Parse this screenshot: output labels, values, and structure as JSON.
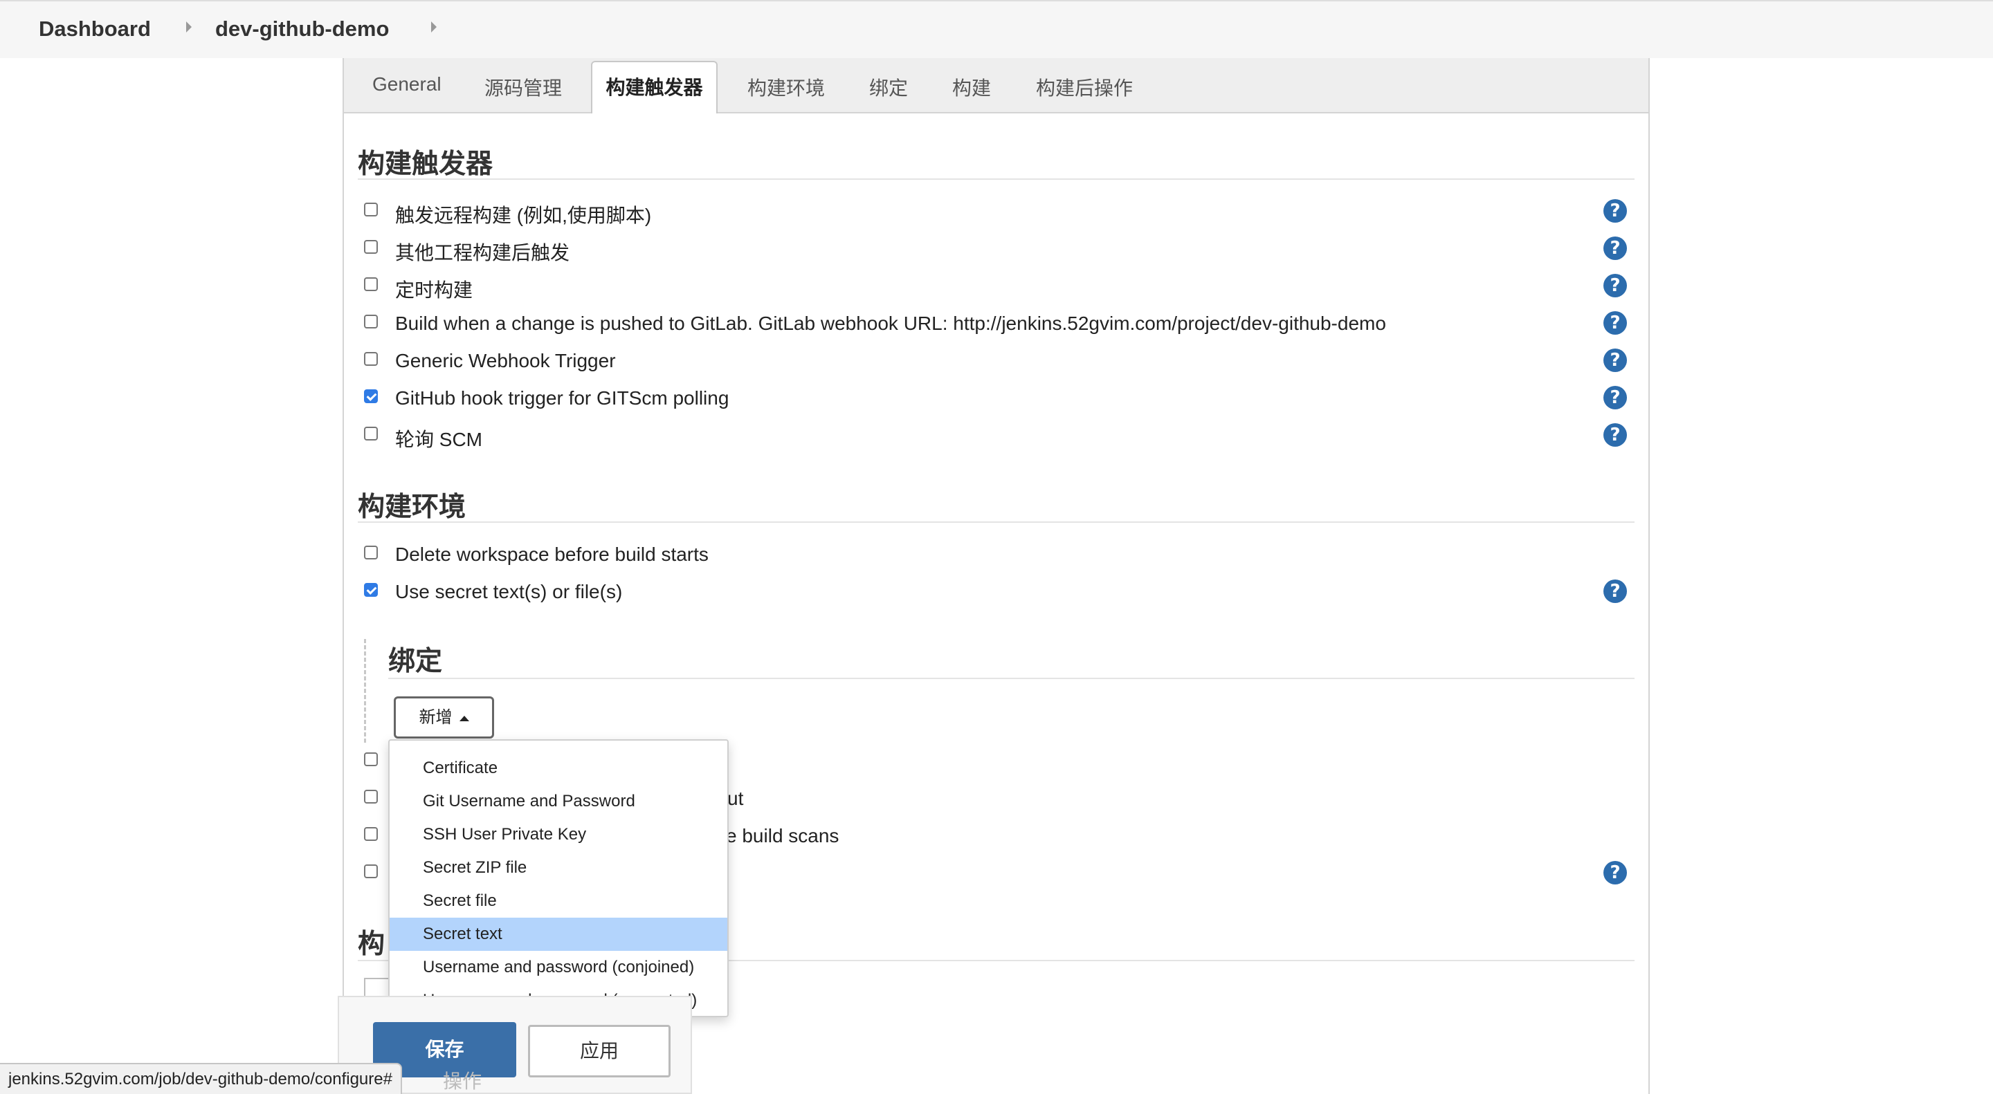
{
  "breadcrumb": {
    "items": [
      "Dashboard",
      "dev-github-demo"
    ]
  },
  "tabs": [
    "General",
    "源码管理",
    "构建触发器",
    "构建环境",
    "绑定",
    "构建",
    "构建后操作"
  ],
  "active_tab": "构建触发器",
  "sections": {
    "triggers": {
      "title": "构建触发器",
      "items": [
        {
          "label": "触发远程构建 (例如,使用脚本)",
          "checked": false
        },
        {
          "label": "其他工程构建后触发",
          "checked": false
        },
        {
          "label": "定时构建",
          "checked": false
        },
        {
          "label": "Build when a change is pushed to GitLab. GitLab webhook URL: http://jenkins.52gvim.com/project/dev-github-demo",
          "checked": false
        },
        {
          "label": "Generic Webhook Trigger",
          "checked": false
        },
        {
          "label": "GitHub hook trigger for GITScm polling",
          "checked": true
        },
        {
          "label": "轮询 SCM",
          "checked": false
        }
      ]
    },
    "env": {
      "title": "构建环境",
      "items": [
        {
          "label": "Delete workspace before build starts",
          "checked": false
        },
        {
          "label": "Use secret text(s) or file(s)",
          "checked": true
        }
      ],
      "partial_labels": [
        "ut",
        "e build scans"
      ]
    },
    "bindings": {
      "title": "绑定",
      "add_button": "新增",
      "dropdown": [
        "Certificate",
        "Git Username and Password",
        "SSH User Private Key",
        "Secret ZIP file",
        "Secret file",
        "Secret text",
        "Username and password (conjoined)",
        "Username and password (separated)"
      ],
      "highlighted": "Secret text"
    },
    "build_partial": {
      "title": "构"
    }
  },
  "actions": {
    "save": "保存",
    "apply": "应用"
  },
  "ghost_text": "操作",
  "help_glyph": "?",
  "status_url": "jenkins.52gvim.com/job/dev-github-demo/configure#",
  "colors": {
    "primary": "#3a6fa8",
    "help": "#2c6cad",
    "highlight": "#b3d4fc",
    "checkbox": "#2f7be5"
  }
}
